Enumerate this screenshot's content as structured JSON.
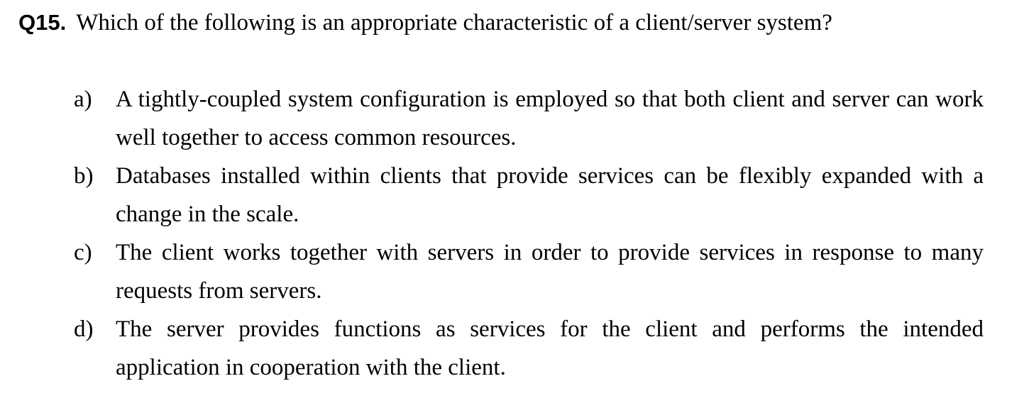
{
  "question": {
    "number": "Q15.",
    "text": "Which of the following is an appropriate characteristic of a client/server system?"
  },
  "options": [
    {
      "label": "a)",
      "text": "A tightly-coupled system configuration is employed so that both client and server can work well together to access common resources."
    },
    {
      "label": "b)",
      "text": "Databases installed within clients that provide services can be flexibly expanded with a change in the scale."
    },
    {
      "label": "c)",
      "text": "The client works together with servers in order to provide services in response to many requests from servers."
    },
    {
      "label": "d)",
      "text": "The server provides functions as services for the client and performs the intended application in cooperation with the client."
    }
  ]
}
